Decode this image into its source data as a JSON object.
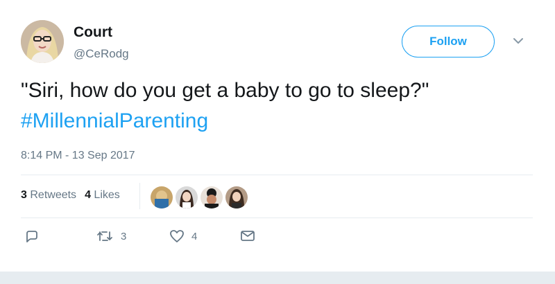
{
  "user": {
    "name": "Court",
    "handle": "@CeRodg"
  },
  "follow_button": {
    "label": "Follow"
  },
  "tweet": {
    "text": "\"Siri, how do you get a baby to go to sleep?\"",
    "hashtag": "#MillennialParenting",
    "timestamp": "8:14 PM - 13 Sep 2017"
  },
  "stats": {
    "retweets_count": "3",
    "retweets_label": "Retweets",
    "likes_count": "4",
    "likes_label": "Likes"
  },
  "likers": [
    {
      "icon": "avatar-liker-1"
    },
    {
      "icon": "avatar-liker-2"
    },
    {
      "icon": "avatar-liker-3"
    },
    {
      "icon": "avatar-liker-4"
    }
  ],
  "actions": {
    "reply": {
      "icon": "reply-icon",
      "count": ""
    },
    "retweet": {
      "icon": "retweet-icon",
      "count": "3"
    },
    "like": {
      "icon": "heart-icon",
      "count": "4"
    },
    "message": {
      "icon": "envelope-icon",
      "count": ""
    }
  },
  "colors": {
    "accent": "#1da1f2",
    "text": "#14171a",
    "secondary": "#657786",
    "divider": "#e6ecf0"
  }
}
